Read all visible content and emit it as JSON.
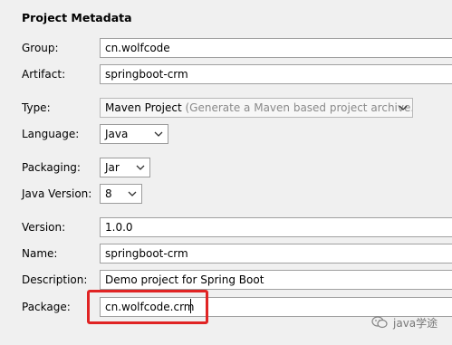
{
  "section_title": "Project Metadata",
  "fields": {
    "group": {
      "label": "Group:",
      "value": "cn.wolfcode"
    },
    "artifact": {
      "label": "Artifact:",
      "value": "springboot-crm"
    },
    "type": {
      "label": "Type:",
      "value": "Maven Project",
      "hint": "(Generate a Maven based project archive.)"
    },
    "language": {
      "label": "Language:",
      "value": "Java"
    },
    "packaging": {
      "label": "Packaging:",
      "value": "Jar"
    },
    "java_version": {
      "label": "Java Version:",
      "value": "8"
    },
    "version": {
      "label": "Version:",
      "value": "1.0.0"
    },
    "name": {
      "label": "Name:",
      "value": "springboot-crm"
    },
    "description": {
      "label": "Description:",
      "value": "Demo project for Spring Boot"
    },
    "package": {
      "label": "Package:",
      "value": "cn.wolfcode.crm"
    }
  },
  "icons": {
    "dropdown": "chevron-down-icon",
    "watermark": "wechat-icon"
  },
  "colors": {
    "highlight": "#e02424",
    "background": "#f0f0f0"
  },
  "watermark_text": "java学途"
}
